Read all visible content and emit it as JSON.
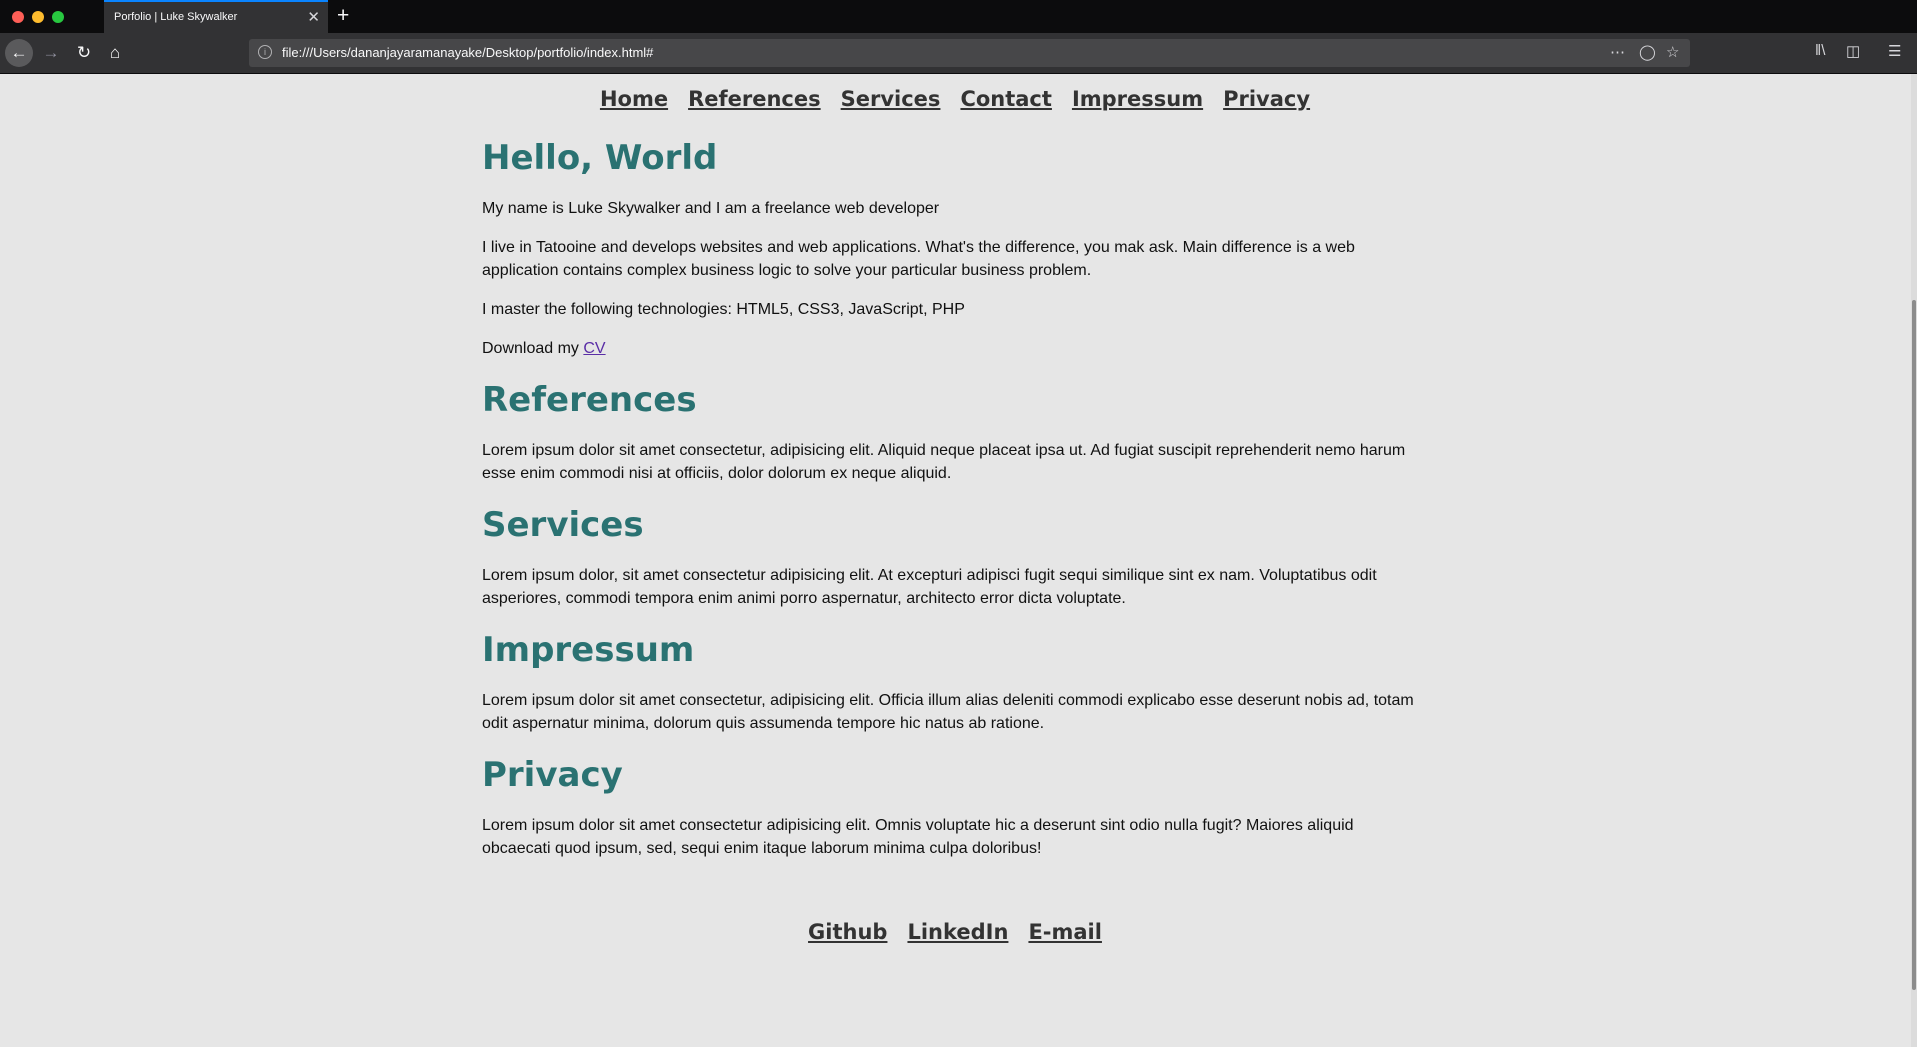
{
  "browser": {
    "tab_title": "Porfolio | Luke Skywalker",
    "tab_close": "✕",
    "new_tab": "+",
    "url": "file:///Users/dananjayaramanayake/Desktop/portfolio/index.html#",
    "icons": [
      "back-icon",
      "forward-icon",
      "reload-icon",
      "home-icon",
      "info-icon",
      "more-icon",
      "pocket-icon",
      "bookmark-star-icon",
      "library-icon",
      "sidebar-icon",
      "menu-icon"
    ]
  },
  "nav": {
    "items": [
      "Home",
      "References",
      "Services",
      "Contact",
      "Impressum",
      "Privacy"
    ]
  },
  "hello": {
    "title": "Hello, World",
    "p1": "My name is Luke Skywalker and I am a freelance web developer",
    "p2": "I live in Tatooine and develops websites and web applications. What's the difference, you mak ask. Main difference is a web application contains complex business logic to solve your particular business problem.",
    "p3": "I master the following technologies: HTML5, CSS3, JavaScript, PHP",
    "p4_prefix": "Download my ",
    "cv_link": "CV"
  },
  "references": {
    "title": "References",
    "text": "Lorem ipsum dolor sit amet consectetur, adipisicing elit. Aliquid neque placeat ipsa ut. Ad fugiat suscipit reprehenderit nemo harum esse enim commodi nisi at officiis, dolor dolorum ex neque aliquid."
  },
  "services": {
    "title": "Services",
    "text": "Lorem ipsum dolor, sit amet consectetur adipisicing elit. At excepturi adipisci fugit sequi similique sint ex nam. Voluptatibus odit asperiores, commodi tempora enim animi porro aspernatur, architecto error dicta voluptate."
  },
  "impressum": {
    "title": "Impressum",
    "text": "Lorem ipsum dolor sit amet consectetur, adipisicing elit. Officia illum alias deleniti commodi explicabo esse deserunt nobis ad, totam odit aspernatur minima, dolorum quis assumenda tempore hic natus ab ratione."
  },
  "privacy": {
    "title": "Privacy",
    "text": "Lorem ipsum dolor sit amet consectetur adipisicing elit. Omnis voluptate hic a deserunt sint odio nulla fugit? Maiores aliquid obcaecati quod ipsum, sed, sequi enim itaque laborum minima culpa doloribus!"
  },
  "footer": {
    "links": [
      "Github",
      "LinkedIn",
      "E-mail"
    ]
  }
}
